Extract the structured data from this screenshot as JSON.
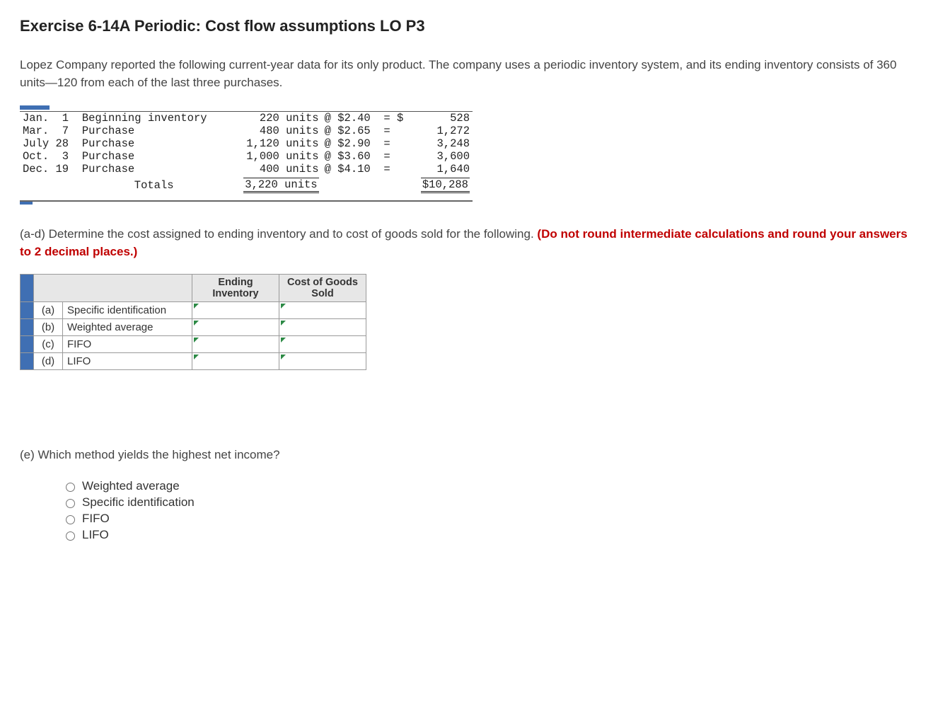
{
  "title": "Exercise 6-14A Periodic: Cost flow assumptions LO P3",
  "intro": "Lopez Company reported the following current-year data for its only product. The company uses a periodic inventory system, and its ending inventory consists of 360 units—120 from each of the last three purchases.",
  "inventory": {
    "rows": [
      {
        "date": "Jan.  1",
        "desc": "Beginning inventory",
        "units": "220 units",
        "at": "@ $2.40",
        "eq": "= $",
        "amount": "528"
      },
      {
        "date": "Mar.  7",
        "desc": "Purchase",
        "units": "480 units",
        "at": "@ $2.65",
        "eq": "=",
        "amount": "1,272"
      },
      {
        "date": "July 28",
        "desc": "Purchase",
        "units": "1,120 units",
        "at": "@ $2.90",
        "eq": "=",
        "amount": "3,248"
      },
      {
        "date": "Oct.  3",
        "desc": "Purchase",
        "units": "1,000 units",
        "at": "@ $3.60",
        "eq": "=",
        "amount": "3,600"
      },
      {
        "date": "Dec. 19",
        "desc": "Purchase",
        "units": "400 units",
        "at": "@ $4.10",
        "eq": "=",
        "amount": "1,640"
      }
    ],
    "totals_label": "Totals",
    "totals_units": "3,220 units",
    "totals_amount": "$10,288"
  },
  "ad_plain": "(a-d) Determine the cost assigned to ending inventory and to cost of goods sold for the following. ",
  "ad_red": "(Do not round intermediate calculations and round your answers to 2 decimal places.)",
  "grid": {
    "col_ei": "Ending Inventory",
    "col_cogs": "Cost of Goods Sold",
    "rows": [
      {
        "letter": "(a)",
        "method": "Specific identification"
      },
      {
        "letter": "(b)",
        "method": "Weighted average"
      },
      {
        "letter": "(c)",
        "method": "FIFO"
      },
      {
        "letter": "(d)",
        "method": "LIFO"
      }
    ]
  },
  "e_question": "(e) Which method yields the highest net income?",
  "options": [
    "Weighted average",
    "Specific identification",
    "FIFO",
    "LIFO"
  ]
}
